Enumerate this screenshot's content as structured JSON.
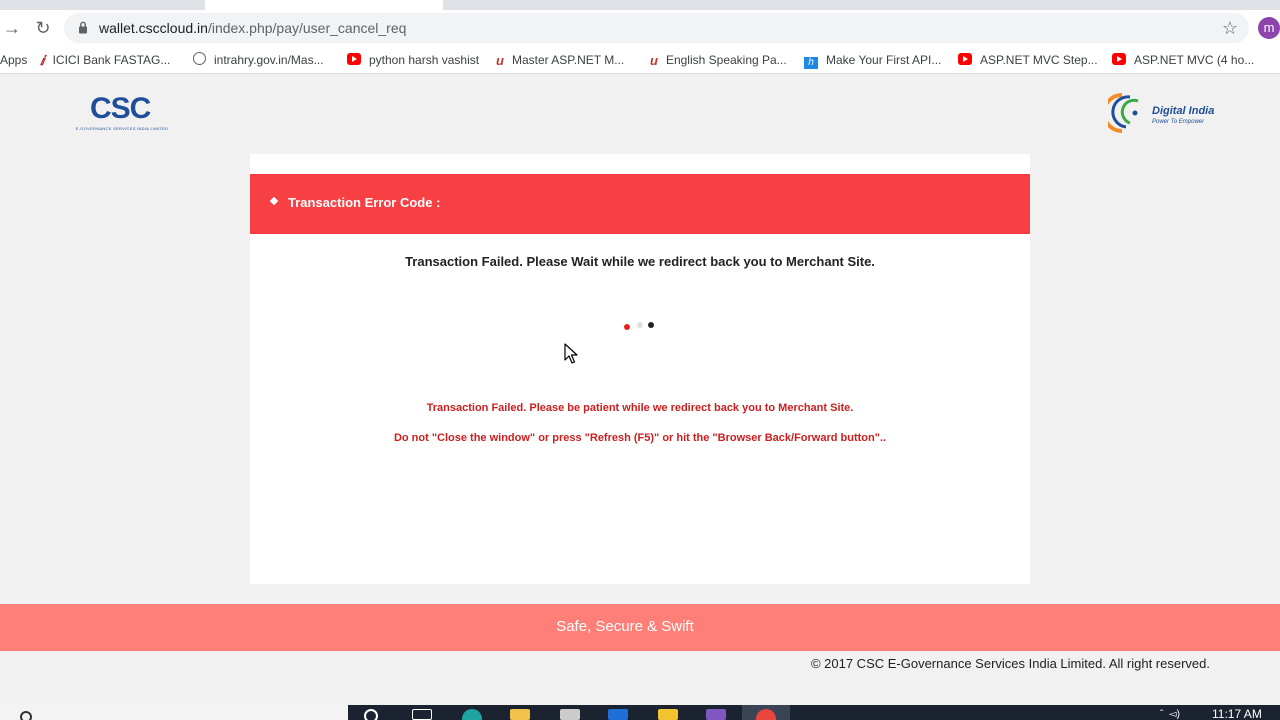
{
  "browser": {
    "url_host": "wallet.csccloud.in",
    "url_path": "/index.php/pay/user_cancel_req",
    "profile_initial": "m",
    "bookmarks": [
      {
        "label": "Apps",
        "icon": "apps-icon"
      },
      {
        "label": "ICICI Bank FASTAG...",
        "icon": "icici-icon"
      },
      {
        "label": "intrahry.gov.in/Mas...",
        "icon": "globe-icon"
      },
      {
        "label": "python harsh vashist",
        "icon": "youtube-icon"
      },
      {
        "label": "Master ASP.NET M...",
        "icon": "udemy-icon"
      },
      {
        "label": "English Speaking Pa...",
        "icon": "udemy-icon"
      },
      {
        "label": "Make Your First API...",
        "icon": "h-icon"
      },
      {
        "label": "ASP.NET MVC Step...",
        "icon": "youtube-icon"
      },
      {
        "label": "ASP.NET MVC (4 ho...",
        "icon": "youtube-icon"
      }
    ]
  },
  "header": {
    "csc_logo_text": "CSC",
    "csc_logo_tagline": "E-GOVERNANCE SERVICES INDIA LIMITED",
    "digital_india_text": "Digital India",
    "digital_india_sub": "Power To Empower"
  },
  "card": {
    "error_title": "Transaction Error Code :",
    "main_message": "Transaction Failed. Please Wait while we redirect back you to Merchant Site.",
    "notice_1": "Transaction Failed. Please be patient while we redirect back you to Merchant Site.",
    "notice_2": "Do not \"Close the window\" or press \"Refresh (F5)\" or hit the \"Browser Back/Forward button\"..",
    "loader_colors": [
      "#e8211c",
      "#e0e0e0",
      "#222222"
    ]
  },
  "footer": {
    "slogan": "Safe, Secure & Swift",
    "copyright": "© 2017 CSC E-Governance Services India Limited. All right reserved."
  },
  "taskbar": {
    "time": "11:17 AM"
  },
  "colors": {
    "error_bar": "#f64044",
    "footer_band": "#fe7f78",
    "notice_text": "#cc1f1f",
    "brand_blue": "#1f4e9b"
  }
}
